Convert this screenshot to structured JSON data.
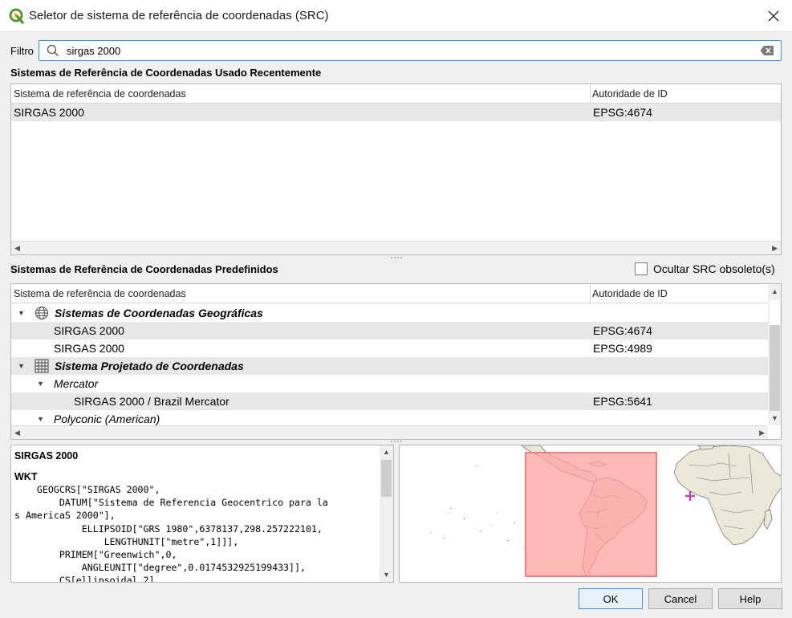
{
  "window": {
    "title": "Seletor de sistema de referência de coordenadas (SRC)",
    "icon": "qgis-logo-icon"
  },
  "filter": {
    "label": "Filtro",
    "value": "sirgas 2000"
  },
  "recent": {
    "title": "Sistemas de Referência de Coordenadas Usado Recentemente",
    "columns": [
      "Sistema de referência de coordenadas",
      "Autoridade de ID"
    ],
    "rows": [
      {
        "name": "SIRGAS 2000",
        "authority": "EPSG:4674"
      }
    ]
  },
  "predefined": {
    "title": "Sistemas de Referência de Coordenadas Predefinidos",
    "hide_deprecated_label": "Ocultar SRC obsoleto(s)",
    "hide_deprecated_checked": false,
    "columns": [
      "Sistema de referência de coordenadas",
      "Autoridade de ID"
    ],
    "tree": {
      "geo_group": "Sistemas de Coordenadas Geográficas",
      "geo_rows": [
        {
          "name": "SIRGAS 2000",
          "authority": "EPSG:4674"
        },
        {
          "name": "SIRGAS 2000",
          "authority": "EPSG:4989"
        }
      ],
      "proj_group": "Sistema Projetado de Coordenadas",
      "mercator_label": "Mercator",
      "mercator_rows": [
        {
          "name": "SIRGAS 2000 / Brazil Mercator",
          "authority": "EPSG:5641"
        }
      ],
      "polyconic_label": "Polyconic (American)"
    }
  },
  "details": {
    "crs_name": "SIRGAS 2000",
    "wkt_heading": "WKT",
    "wkt_text": "    GEOGCRS[\"SIRGAS 2000\",\n        DATUM[\"Sistema de Referencia Geocentrico para la\ns AmericaS 2000\"],\n            ELLIPSOID[\"GRS 1980\",6378137,298.257222101,\n                LENGTHUNIT[\"metre\",1]]],\n        PRIMEM[\"Greenwich\",0,\n            ANGLEUNIT[\"degree\",0.0174532925199433]],\n        CS[ellipsoidal,2],"
  },
  "colors": {
    "extent_fill": "#ffb3b3",
    "extent_stroke": "#f08080",
    "land": "#ece8d8",
    "cursor": "#c040c0"
  },
  "buttons": {
    "ok": "OK",
    "cancel": "Cancel",
    "help": "Help"
  }
}
